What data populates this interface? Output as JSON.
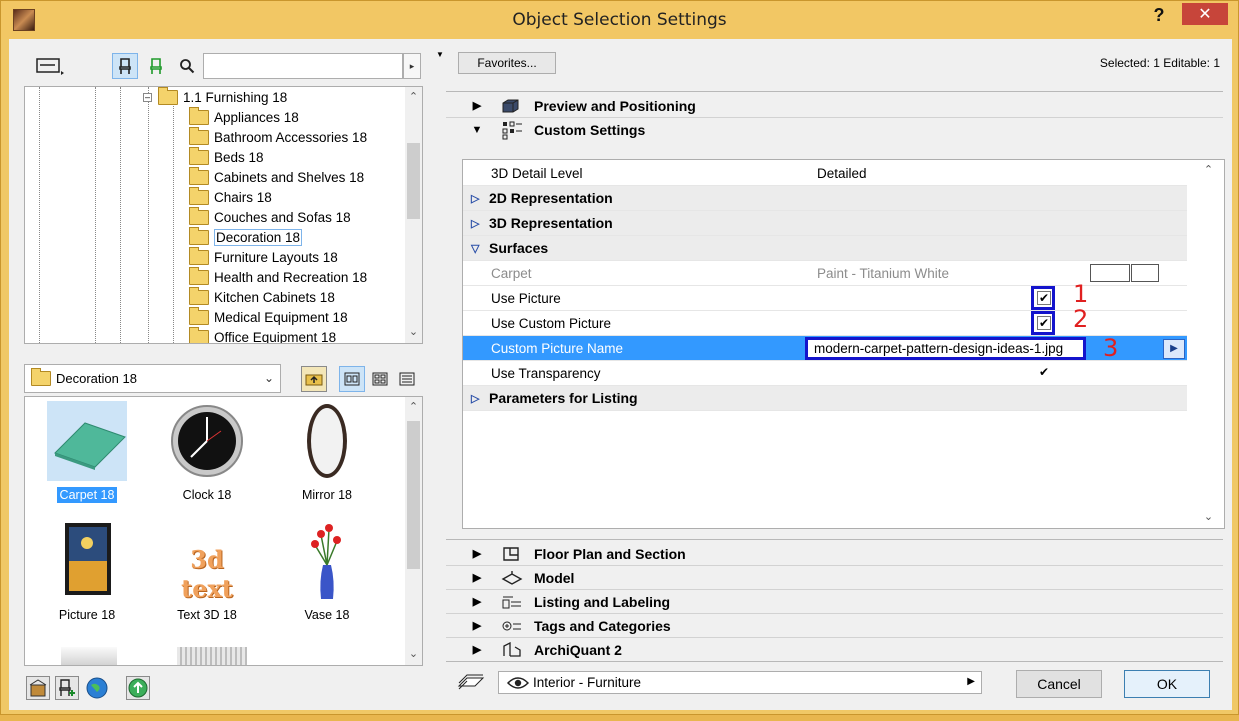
{
  "window": {
    "title": "Object Selection Settings",
    "help": "?",
    "close": "✕"
  },
  "left": {
    "tree": {
      "root": "1.1 Furnishing 18",
      "items": [
        "Appliances 18",
        "Bathroom Accessories 18",
        "Beds 18",
        "Cabinets and Shelves 18",
        "Chairs 18",
        "Couches and Sofas 18",
        "Decoration 18",
        "Furniture Layouts 18",
        "Health and Recreation 18",
        "Kitchen Cabinets 18",
        "Medical Equipment 18",
        "Office Equipment 18"
      ],
      "selected": "Decoration 18"
    },
    "library_folder": "Decoration 18",
    "gallery": [
      {
        "label": "Carpet 18",
        "icon": "carpet-icon",
        "selected": true
      },
      {
        "label": "Clock 18",
        "icon": "clock-icon",
        "selected": false
      },
      {
        "label": "Mirror 18",
        "icon": "mirror-icon",
        "selected": false
      },
      {
        "label": "Picture 18",
        "icon": "picture-icon",
        "selected": false
      },
      {
        "label": "Text 3D 18",
        "icon": "text-3d-icon",
        "selected": false,
        "art_text": "3d text"
      },
      {
        "label": "Vase 18",
        "icon": "vase-icon",
        "selected": false
      }
    ]
  },
  "right": {
    "favorites_label": "Favorites...",
    "selection_info": "Selected: 1 Editable: 1",
    "sections_top": [
      {
        "label": "Preview and Positioning",
        "expanded": false
      },
      {
        "label": "Custom Settings",
        "expanded": true
      }
    ],
    "properties": [
      {
        "name": "3D Detail Level",
        "value": "Detailed"
      },
      {
        "group": "2D Representation"
      },
      {
        "group": "3D Representation"
      },
      {
        "group": "Surfaces",
        "expanded": true
      },
      {
        "name": "Carpet",
        "value": "Paint - Titanium White"
      },
      {
        "name": "Use Picture",
        "checked": true,
        "annotation": "1"
      },
      {
        "name": "Use Custom Picture",
        "checked": true,
        "annotation": "2"
      },
      {
        "name": "Custom Picture Name",
        "value": "modern-carpet-pattern-design-ideas-1.jpg",
        "annotation": "3"
      },
      {
        "name": "Use Transparency",
        "checked": true
      },
      {
        "group": "Parameters for Listing"
      }
    ],
    "sections_bottom": [
      {
        "label": "Floor Plan and Section"
      },
      {
        "label": "Model"
      },
      {
        "label": "Listing and Labeling"
      },
      {
        "label": "Tags and Categories"
      },
      {
        "label": "ArchiQuant 2"
      }
    ],
    "layer": "Interior - Furniture",
    "cancel_label": "Cancel",
    "ok_label": "OK"
  },
  "colors": {
    "title_bar": "#f2c764",
    "selection_blue": "#3399ff",
    "highlight_box": "#1414cc",
    "annotation_red": "#e02020",
    "close_red": "#c7453a"
  }
}
